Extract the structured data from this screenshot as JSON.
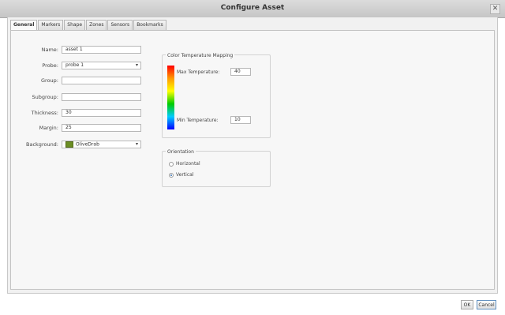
{
  "window": {
    "title": "Configure Asset",
    "close_glyph": "✕"
  },
  "tabs": [
    {
      "label": "General",
      "active": true
    },
    {
      "label": "Markers"
    },
    {
      "label": "Shape"
    },
    {
      "label": "Zones"
    },
    {
      "label": "Sensors"
    },
    {
      "label": "Bookmarks"
    }
  ],
  "form": {
    "name": {
      "label": "Name:",
      "value": "asset 1"
    },
    "probe": {
      "label": "Probe:",
      "value": "probe 1"
    },
    "group": {
      "label": "Group:",
      "value": ""
    },
    "subgroup": {
      "label": "Subgroup:",
      "value": ""
    },
    "thickness": {
      "label": "Thickness:",
      "value": "30"
    },
    "margin": {
      "label": "Margin:",
      "value": "25"
    },
    "background": {
      "label": "Background:",
      "value": "OliveDrab",
      "color": "#6b8e23"
    }
  },
  "color_mapping": {
    "title": "Color Temperature Mapping",
    "max": {
      "label": "Max Temperature:",
      "value": "40"
    },
    "min": {
      "label": "Min Temperature:",
      "value": "10"
    }
  },
  "orientation": {
    "title": "Orientation",
    "horizontal": "Horizontal",
    "vertical": "Vertical",
    "selected": "vertical"
  },
  "buttons": {
    "ok": "OK",
    "cancel": "Cancel"
  },
  "icons": {
    "dropdown": "▾"
  }
}
